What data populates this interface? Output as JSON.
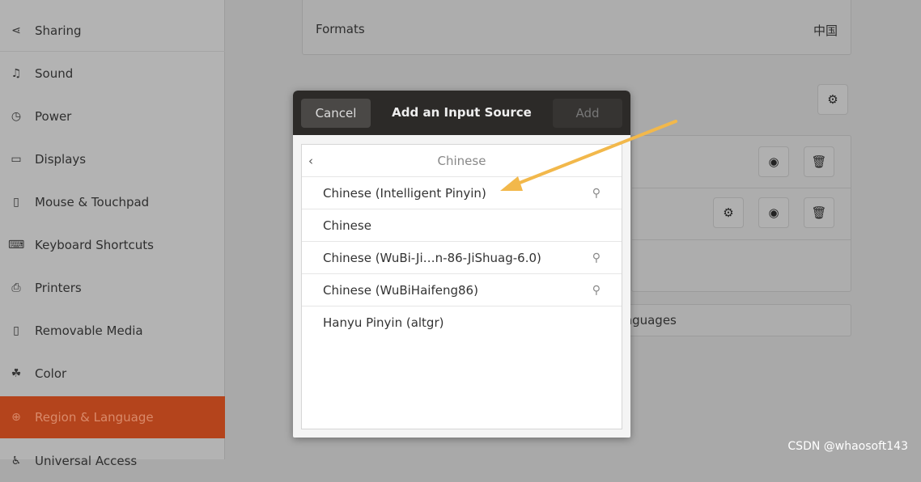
{
  "sidebar": {
    "items": [
      {
        "label": "Sharing",
        "icon": "share-icon"
      },
      {
        "label": "Sound",
        "icon": "music-note-icon"
      },
      {
        "label": "Power",
        "icon": "power-icon"
      },
      {
        "label": "Displays",
        "icon": "display-icon"
      },
      {
        "label": "Mouse & Touchpad",
        "icon": "mouse-icon"
      },
      {
        "label": "Keyboard Shortcuts",
        "icon": "keyboard-icon"
      },
      {
        "label": "Printers",
        "icon": "printer-icon"
      },
      {
        "label": "Removable Media",
        "icon": "removable-media-icon"
      },
      {
        "label": "Color",
        "icon": "color-icon"
      },
      {
        "label": "Region & Language",
        "icon": "globe-icon",
        "active": true
      },
      {
        "label": "Universal Access",
        "icon": "accessibility-icon"
      }
    ]
  },
  "main": {
    "formats_label": "Formats",
    "formats_value": "中国",
    "manage_languages": "Manage Installed Languages"
  },
  "dialog": {
    "cancel": "Cancel",
    "title": "Add an Input Source",
    "add": "Add",
    "section": "Chinese",
    "items": [
      {
        "label": "Chinese (Intelligent Pinyin)",
        "has_settings": true
      },
      {
        "label": "Chinese",
        "has_settings": false
      },
      {
        "label": "Chinese (WuBi-Ji…n-86-JiShuag-6.0)",
        "has_settings": true
      },
      {
        "label": "Chinese (WuBiHaifeng86)",
        "has_settings": true
      },
      {
        "label": "Hanyu Pinyin (altgr)",
        "has_settings": false
      }
    ]
  },
  "accent_color": "#b4441c",
  "annotation_arrow_color": "#f2b84b",
  "watermark": "CSDN @whaosoft143"
}
